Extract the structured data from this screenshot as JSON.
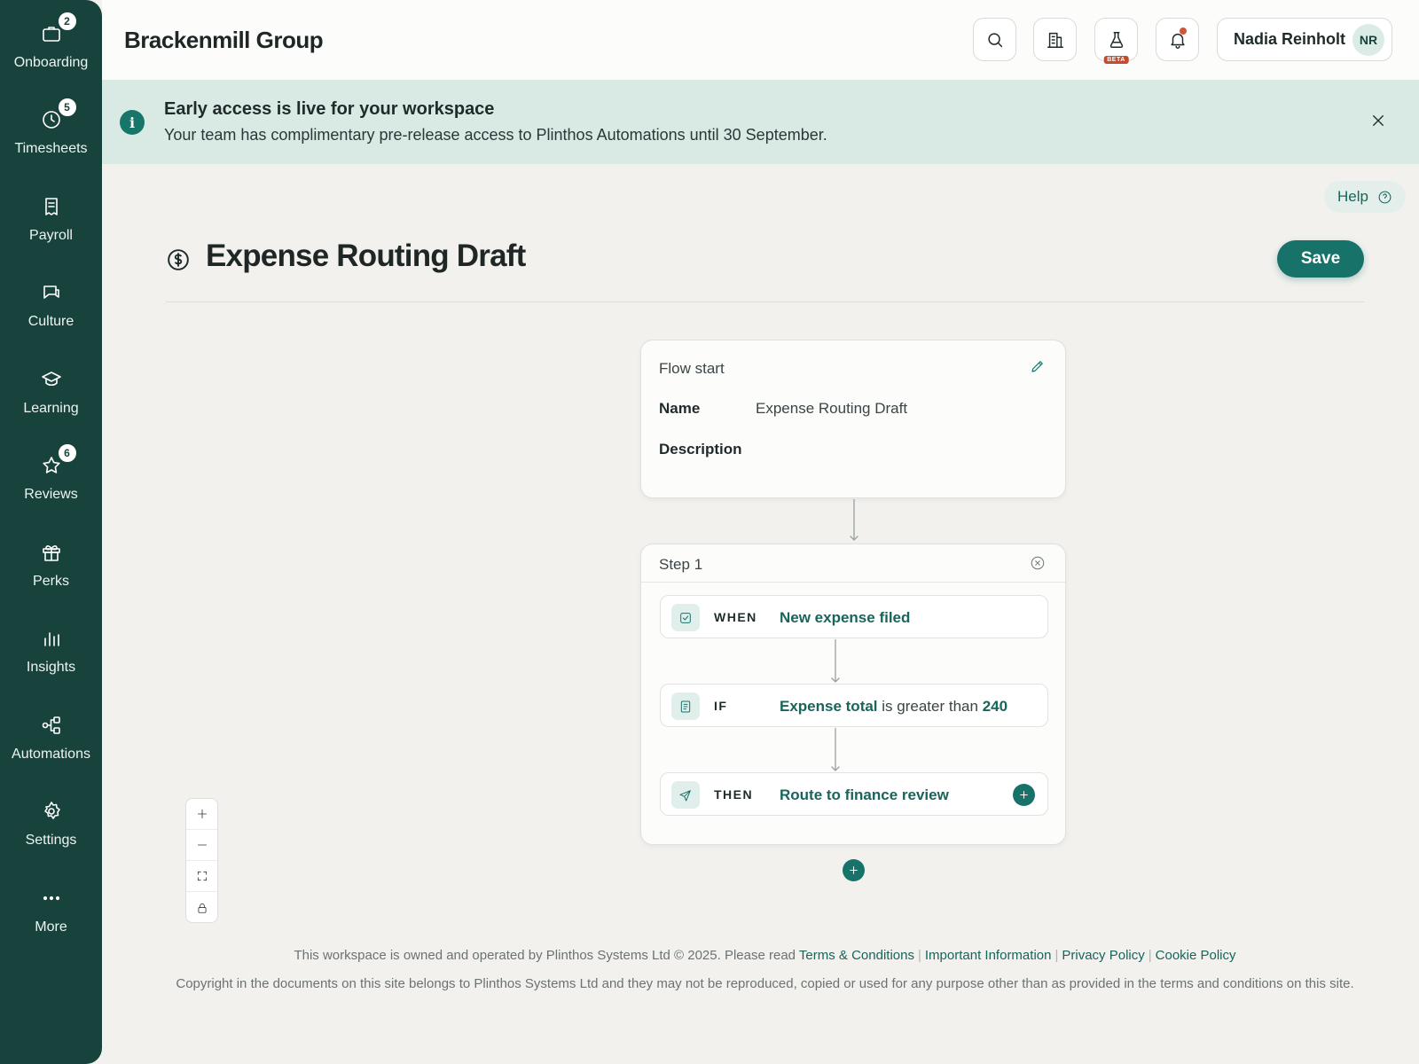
{
  "sidebar": {
    "items": [
      {
        "label": "Onboarding",
        "icon": "briefcase-icon",
        "badge": "2"
      },
      {
        "label": "Timesheets",
        "icon": "clock-icon",
        "badge": "5"
      },
      {
        "label": "Payroll",
        "icon": "receipt-icon",
        "badge": ""
      },
      {
        "label": "Culture",
        "icon": "chat-icon",
        "badge": ""
      },
      {
        "label": "Learning",
        "icon": "graduation-cap-icon",
        "badge": ""
      },
      {
        "label": "Reviews",
        "icon": "star-icon",
        "badge": "6"
      },
      {
        "label": "Perks",
        "icon": "gift-icon",
        "badge": ""
      },
      {
        "label": "Insights",
        "icon": "bar-chart-icon",
        "badge": ""
      },
      {
        "label": "Automations",
        "icon": "flow-icon",
        "badge": ""
      },
      {
        "label": "Settings",
        "icon": "gear-icon",
        "badge": ""
      },
      {
        "label": "More",
        "icon": "more-dots-icon",
        "badge": ""
      }
    ]
  },
  "header": {
    "brand": "Brackenmill Group",
    "beta_tag": "BETA",
    "user_name": "Nadia Reinholt",
    "user_initials": "NR"
  },
  "banner": {
    "title": "Early access is live for your workspace",
    "text": "Your team has complimentary pre-release access to Plinthos Automations until 30 September.",
    "icon_glyph": "i"
  },
  "help_label": "Help",
  "page": {
    "title": "Expense Routing Draft",
    "save_label": "Save"
  },
  "flow_start": {
    "heading": "Flow start",
    "name_label": "Name",
    "name_value": "Expense Routing Draft",
    "description_label": "Description",
    "description_value": ""
  },
  "step": {
    "heading": "Step 1",
    "when": {
      "keyword": "WHEN",
      "text": "New expense filed"
    },
    "if": {
      "keyword": "IF",
      "field": "Expense total",
      "operator": "is greater than",
      "value": "240"
    },
    "then": {
      "keyword": "THEN",
      "text": "Route to finance review"
    }
  },
  "footer": {
    "line1_prefix": "This workspace is owned and operated by Plinthos Systems Ltd © 2025. Please read",
    "links": [
      "Terms & Conditions",
      "Important Information",
      "Privacy Policy",
      "Cookie Policy"
    ],
    "separator": "|",
    "line2": "Copyright in the documents on this site belongs to Plinthos Systems Ltd and they may not be reproduced, copied or used for any purpose other than as provided in the terms and conditions on this site."
  },
  "colors": {
    "sidebar": "#17433c",
    "accent": "#17726a",
    "banner": "#d9e9e4",
    "background": "#f2f1ee"
  }
}
